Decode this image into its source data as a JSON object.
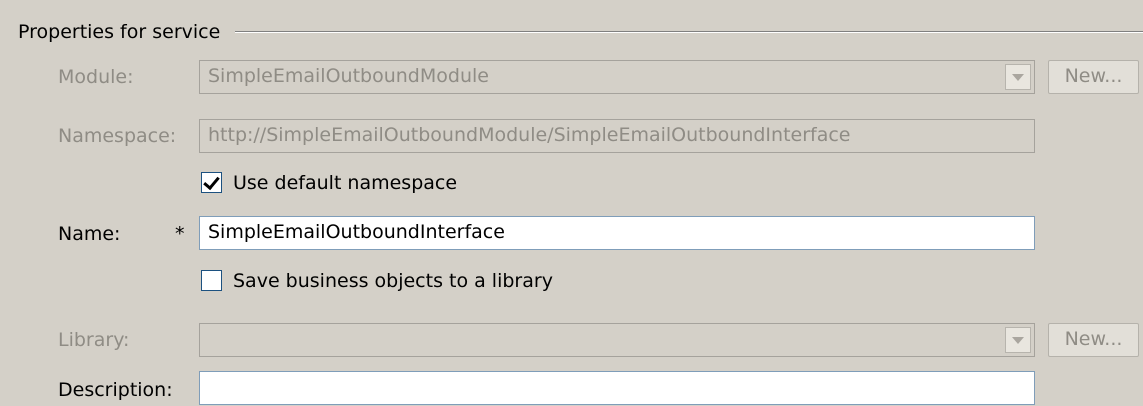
{
  "group": {
    "title": "Properties for service"
  },
  "module": {
    "label": "Module:",
    "value": "SimpleEmailOutboundModule",
    "new_label": "New..."
  },
  "namespace": {
    "label": "Namespace:",
    "value": "http://SimpleEmailOutboundModule/SimpleEmailOutboundInterface"
  },
  "use_default_namespace": {
    "label": "Use default namespace",
    "checked": true
  },
  "name": {
    "label": "Name:",
    "required_marker": "*",
    "value": "SimpleEmailOutboundInterface"
  },
  "save_to_library": {
    "label": "Save business objects to a library",
    "checked": false
  },
  "library": {
    "label": "Library:",
    "value": "",
    "new_label": "New..."
  },
  "description": {
    "label": "Description:",
    "value": ""
  }
}
